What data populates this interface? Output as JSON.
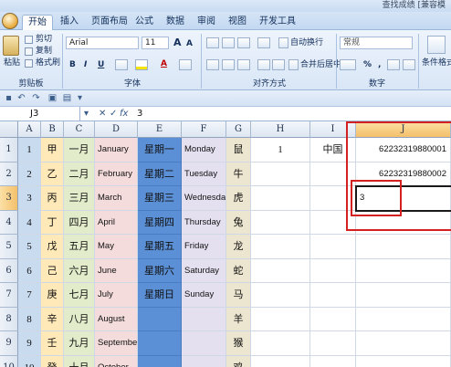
{
  "title_bar": {
    "right_text": "查找成绩 [兼容模"
  },
  "tabs": [
    "开始",
    "插入",
    "页面布局",
    "公式",
    "数据",
    "审阅",
    "视图",
    "开发工具"
  ],
  "ribbon": {
    "clipboard": {
      "paste": "粘贴",
      "cut": "剪切",
      "copy": "复制",
      "format_painter": "格式刷",
      "label": "剪贴板"
    },
    "font": {
      "name": "Arial",
      "size": "11",
      "grow": "A",
      "shrink": "A",
      "bold": "B",
      "italic": "I",
      "underline": "U",
      "color_a": "A",
      "label": "字体"
    },
    "alignment": {
      "wrap": "自动换行",
      "merge": "合并后居中",
      "label": "对齐方式"
    },
    "number": {
      "format": "常规",
      "percent": "%",
      "comma": ",",
      "label": "数字"
    },
    "styles": {
      "conditional": "条件格式"
    }
  },
  "formula_bar": {
    "name_box": "J3",
    "fx": "fx",
    "value": "3"
  },
  "sheet": {
    "col_headers": [
      "A",
      "B",
      "C",
      "D",
      "E",
      "F",
      "G",
      "H",
      "I",
      "J"
    ],
    "row_headers": [
      "1",
      "2",
      "3",
      "4",
      "5",
      "6",
      "7",
      "8",
      "9",
      "10"
    ],
    "col_A": [
      "1",
      "2",
      "3",
      "4",
      "5",
      "6",
      "7",
      "8",
      "9",
      "10"
    ],
    "col_B": [
      "甲",
      "乙",
      "丙",
      "丁",
      "戊",
      "己",
      "庚",
      "辛",
      "壬",
      "癸"
    ],
    "col_C": [
      "一月",
      "二月",
      "三月",
      "四月",
      "五月",
      "六月",
      "七月",
      "八月",
      "九月",
      "十月"
    ],
    "col_D": [
      "January",
      "February",
      "March",
      "April",
      "May",
      "June",
      "July",
      "August",
      "September",
      "October"
    ],
    "col_E": [
      "星期一",
      "星期二",
      "星期三",
      "星期四",
      "星期五",
      "星期六",
      "星期日",
      "",
      "",
      ""
    ],
    "col_F": [
      "Monday",
      "Tuesday",
      "Wednesday",
      "Thursday",
      "Friday",
      "Saturday",
      "Sunday",
      "",
      "",
      ""
    ],
    "col_G": [
      "鼠",
      "牛",
      "虎",
      "兔",
      "龙",
      "蛇",
      "马",
      "羊",
      "猴",
      "鸡"
    ],
    "H1": "1",
    "I1": "中国",
    "J1": "62232319880001",
    "J2": "62232319880002",
    "J3": "3"
  },
  "colors": {
    "col_A": "#c9dbef",
    "col_B": "#ffe9b8",
    "col_C": "#e2eccb",
    "col_D": "#f5dcdc",
    "col_E": "#5b8fd6",
    "col_F": "#e4e0f0",
    "col_G": "#ece5cf",
    "highlight": "#d42020"
  }
}
